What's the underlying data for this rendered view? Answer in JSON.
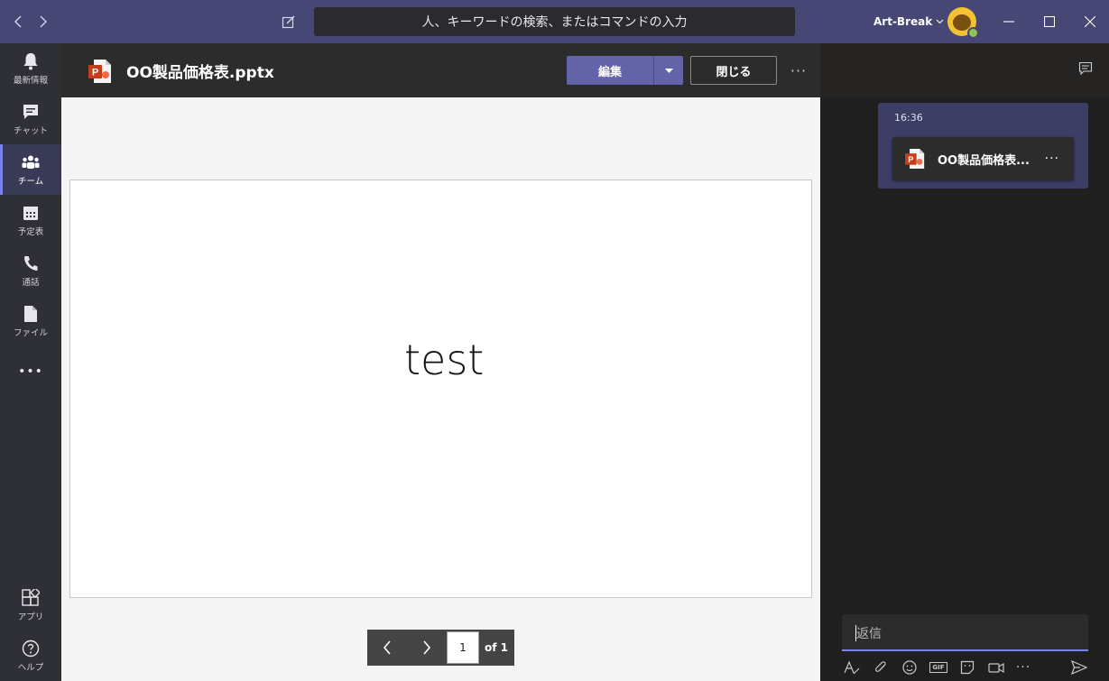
{
  "titlebar": {
    "search_placeholder": "人、キーワードの検索、またはコマンドの入力",
    "user_name": "Art-Break",
    "brand_color": "#464775"
  },
  "rail": {
    "items": [
      {
        "label": "最新情報",
        "icon": "bell-icon"
      },
      {
        "label": "チャット",
        "icon": "chat-icon"
      },
      {
        "label": "チーム",
        "icon": "teams-icon"
      },
      {
        "label": "予定表",
        "icon": "calendar-icon"
      },
      {
        "label": "通話",
        "icon": "phone-icon"
      },
      {
        "label": "ファイル",
        "icon": "file-icon"
      },
      {
        "label": "",
        "icon": "more-icon"
      },
      {
        "label": "アプリ",
        "icon": "apps-icon"
      },
      {
        "label": "ヘルプ",
        "icon": "help-icon"
      }
    ],
    "active": "チーム",
    "more_glyph": "•••"
  },
  "file": {
    "title": "OO製品価格表.pptx",
    "edit_label": "編集",
    "close_label": "閉じる",
    "more_glyph": "···"
  },
  "slide": {
    "text": "test"
  },
  "pager": {
    "current": "1",
    "of_label": "of 1"
  },
  "chat": {
    "message_time": "16:36",
    "attachment_name": "OO製品価格表...",
    "attachment_more": "···",
    "reply_placeholder": "返信",
    "accent": "#7b83eb"
  },
  "composer": {
    "gif_label": "GIF",
    "more_glyph": "···"
  }
}
